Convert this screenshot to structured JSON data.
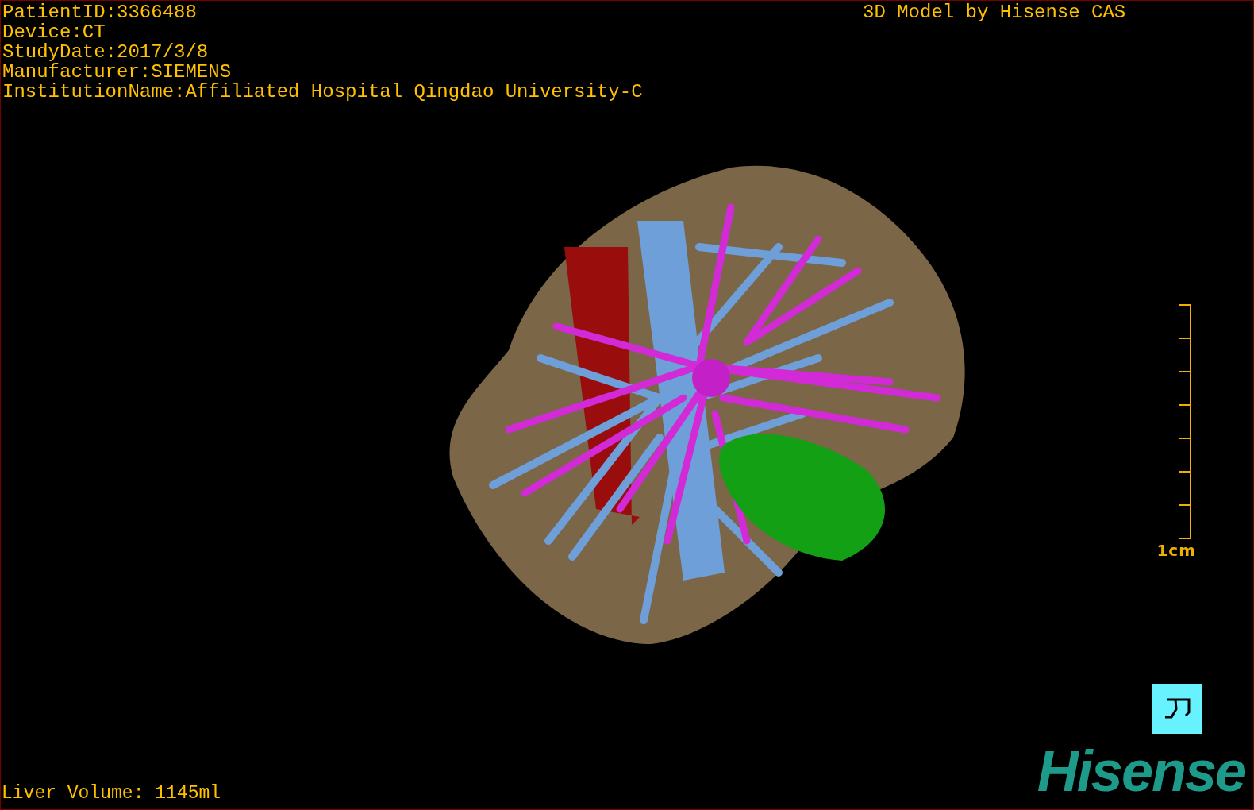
{
  "patient_info": [
    "PatientID:3366488",
    "Device:CT",
    "StudyDate:2017/3/8",
    "Manufacturer:SIEMENS",
    "InstitutionName:Affiliated Hospital Qingdao University-C"
  ],
  "model_credit": "3D Model by Hisense CAS",
  "scale_bar": {
    "label": "1cm"
  },
  "liver_volume": "Liver Volume: 1145ml",
  "logo": "Hisense"
}
